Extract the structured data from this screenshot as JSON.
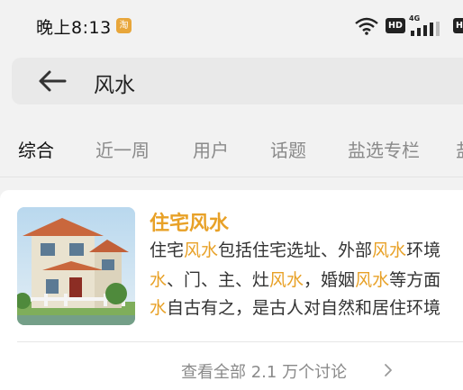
{
  "status_bar": {
    "time": "晚上8:13",
    "notification_badge": "淘",
    "hd_label_1": "HD",
    "hd_label_2": "HD",
    "network": "4G"
  },
  "search": {
    "query": "风水"
  },
  "tabs": [
    {
      "label": "综合",
      "active": true
    },
    {
      "label": "近一周",
      "active": false
    },
    {
      "label": "用户",
      "active": false
    },
    {
      "label": "话题",
      "active": false
    },
    {
      "label": "盐选专栏",
      "active": false
    }
  ],
  "result": {
    "title": "住宅风水",
    "lines": [
      [
        {
          "text": "住宅",
          "hl": false
        },
        {
          "text": "风水",
          "hl": true
        },
        {
          "text": "包括住宅选址、外部",
          "hl": false
        },
        {
          "text": "风水",
          "hl": true
        },
        {
          "text": "环境",
          "hl": false
        }
      ],
      [
        {
          "text": "水",
          "hl": true
        },
        {
          "text": "、门、主、灶",
          "hl": false
        },
        {
          "text": "风水",
          "hl": true
        },
        {
          "text": "，婚姻",
          "hl": false
        },
        {
          "text": "风水",
          "hl": true
        },
        {
          "text": "等方面",
          "hl": false
        }
      ],
      [
        {
          "text": "水",
          "hl": true
        },
        {
          "text": "自古有之，是古人对自然和居住环境",
          "hl": false
        }
      ]
    ],
    "view_all": "查看全部 2.1 万个讨论"
  },
  "colors": {
    "accent": "#e8a127",
    "background": "#f2f2f2"
  }
}
